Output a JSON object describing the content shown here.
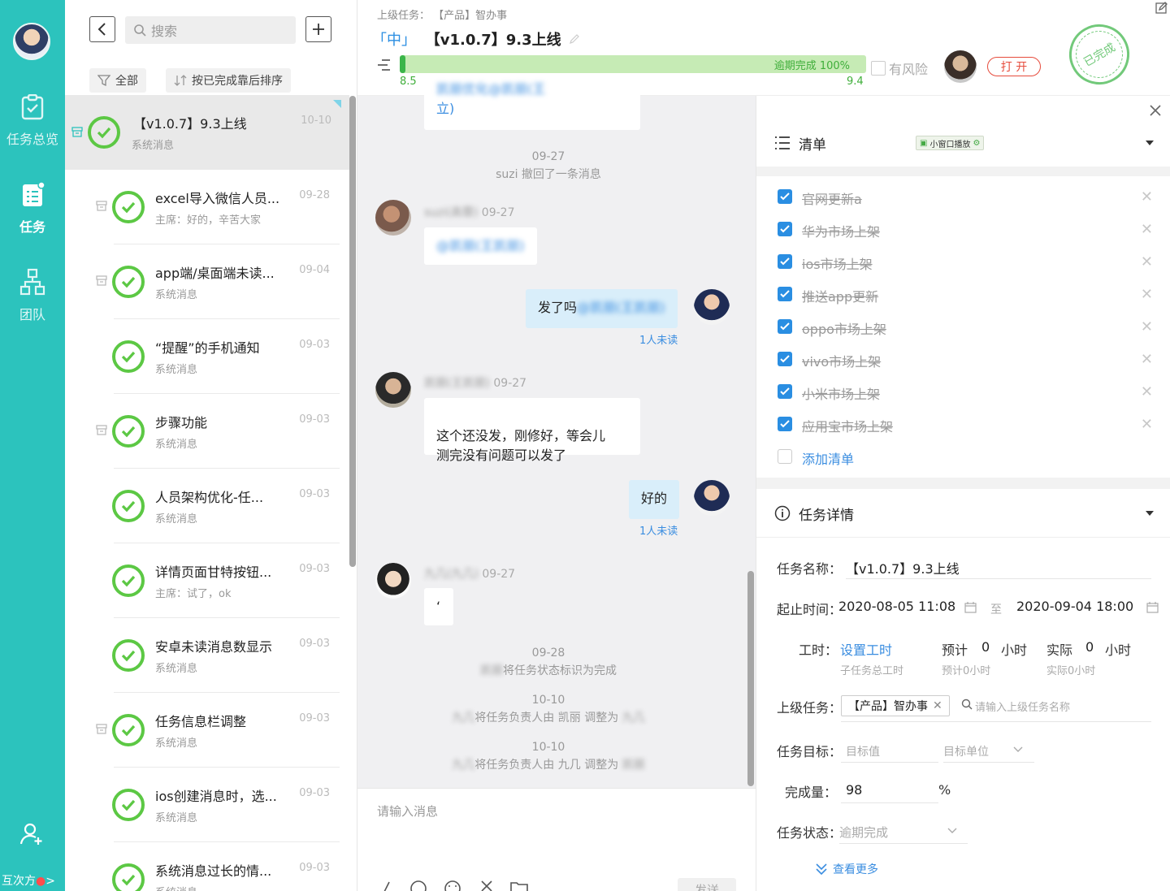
{
  "nav": {
    "overview_label": "任务总览",
    "tasks_label": "任务",
    "team_label": "团队",
    "bottom_label": "互次方"
  },
  "list_panel": {
    "search_placeholder": "搜索",
    "filter_all": "全部",
    "sort_label": "按已完成靠后排序",
    "items": [
      {
        "title": "【v1.0.7】9.3上线",
        "subtitle": "系统消息",
        "date": "10-10"
      },
      {
        "title": "excel导入微信人员...",
        "subtitle": "主席：好的，辛苦大家",
        "date": "09-28"
      },
      {
        "title": "app端/桌面端未读...",
        "subtitle": "系统消息",
        "date": "09-04"
      },
      {
        "title": "“提醒”的手机通知",
        "subtitle": "系统消息",
        "date": "09-03"
      },
      {
        "title": "步骤功能",
        "subtitle": "系统消息",
        "date": "09-03"
      },
      {
        "title": "人员架构优化-任...",
        "subtitle": "系统消息",
        "date": "09-03"
      },
      {
        "title": "详情页面甘特按钮...",
        "subtitle": "主席：试了，ok",
        "date": "09-03"
      },
      {
        "title": "安卓未读消息数显示",
        "subtitle": "系统消息",
        "date": "09-03"
      },
      {
        "title": "任务信息栏调整",
        "subtitle": "系统消息",
        "date": "09-03"
      },
      {
        "title": "ios创建消息时，选...",
        "subtitle": "系统消息",
        "date": "09-03"
      },
      {
        "title": "系统消息过长的情...",
        "subtitle": "系统消息",
        "date": "09-03"
      }
    ]
  },
  "header": {
    "parent_label": "上级任务：",
    "parent_value": "【产品】智办事",
    "priority": "「中」",
    "title": "【v1.0.7】9.3上线",
    "progress_text": "逾期完成 100%",
    "progress_fraction": 1.0,
    "start_mark": "8.5",
    "end_mark": "9.4",
    "risk_label": "有风险",
    "open_button": "打 开",
    "stamp_text": "已完成"
  },
  "chat": {
    "top_bubble_text": "立)",
    "messages": [
      {
        "type": "sys",
        "date": "09-27",
        "text": "suzi 撤回了一条消息"
      },
      {
        "type": "in",
        "sender": "suzi(高蓉)",
        "date": "09-27",
        "text": "@凯丽(王凯丽)"
      },
      {
        "type": "out",
        "text": "发了吗",
        "mention": "@凯丽(王凯丽)",
        "status": "1人未读"
      },
      {
        "type": "in",
        "sender": "凯丽(王凯丽)",
        "date": "09-27",
        "text": "这个还没发，刚修好，等会儿\n测完没有问题可以发了"
      },
      {
        "type": "out",
        "text": "好的",
        "status": "1人未读"
      },
      {
        "type": "in",
        "sender": "九几(九几)",
        "date": "09-27",
        "text": "‘"
      },
      {
        "type": "sys",
        "date": "09-28",
        "text": "将任务状态标识为完成",
        "actor": "凯丽"
      },
      {
        "type": "sys",
        "date": "10-10",
        "text": "将任务负责人由 凯丽 调整为",
        "actor": "九几",
        "target": "九几"
      },
      {
        "type": "sys",
        "date": "10-10",
        "text": "将任务负责人由 九几 调整为",
        "actor": "九几",
        "target": "凯丽"
      }
    ],
    "input_placeholder": "请输入消息",
    "send_label": "发送"
  },
  "checklist": {
    "title": "清单",
    "mini_window_label": "小窗口播放",
    "items": [
      "官网更新a",
      "华为市场上架",
      "ios市场上架",
      "推送app更新",
      "oppo市场上架",
      "vivo市场上架",
      "小米市场上架",
      "应用宝市场上架"
    ],
    "add_label": "添加清单"
  },
  "details": {
    "title": "任务详情",
    "name_label": "任务名称：",
    "name_value": "【v1.0.7】9.3上线",
    "time_label": "起止时间：",
    "start_time": "2020-08-05 11:08",
    "to_label": "至",
    "end_time": "2020-09-04 18:00",
    "hours_label": "工时：",
    "set_hours": "设置工时",
    "sub_hours": "子任务总工时",
    "estimate_label": "预计",
    "estimate_value": "0",
    "unit_hours": "小时",
    "estimate_sub": "预计0小时",
    "actual_label": "实际",
    "actual_value": "0",
    "actual_sub": "实际0小时",
    "parent_label": "上级任务：",
    "parent_tag": "【产品】智办事",
    "parent_placeholder": "请输入上级任务名称",
    "goal_label": "任务目标：",
    "goal_placeholder": "目标值",
    "goal_unit_placeholder": "目标单位",
    "completion_label": "完成量：",
    "completion_value": "98",
    "percent": "%",
    "status_label": "任务状态：",
    "status_value": "逾期完成",
    "more_label": "查看更多"
  },
  "colors": {
    "nav_bg": "#2cc3bd",
    "check_green": "#5cc844",
    "link_blue": "#3a8de0",
    "danger_red": "#e64b3c"
  }
}
